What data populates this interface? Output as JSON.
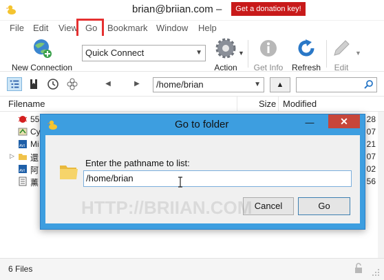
{
  "window": {
    "title": "brian@briian.com –",
    "donate_label": "Get a donation key!"
  },
  "menu": [
    "File",
    "Edit",
    "View",
    "Go",
    "Bookmark",
    "Window",
    "Help"
  ],
  "toolbar": {
    "new_connection": "New Connection",
    "quick_connect": "Quick Connect",
    "action": "Action",
    "get_info": "Get Info",
    "refresh": "Refresh",
    "edit": "Edit"
  },
  "navbar": {
    "path": "/home/brian",
    "search_placeholder": ""
  },
  "list": {
    "columns": {
      "filename": "Filename",
      "size": "Size",
      "modified": "Modified"
    },
    "rows": [
      {
        "name": "55",
        "modified": "28"
      },
      {
        "name": "Cy",
        "modified": "07"
      },
      {
        "name": "Mi",
        "modified": "21"
      },
      {
        "name": "還",
        "modified": "07"
      },
      {
        "name": "阿",
        "modified": "02"
      },
      {
        "name": "薰",
        "modified": "56"
      }
    ]
  },
  "status": {
    "text": "6 Files"
  },
  "dialog": {
    "title": "Go to folder",
    "label": "Enter the pathname to list:",
    "input_value": "/home/brian",
    "cancel": "Cancel",
    "go": "Go"
  },
  "watermark": {
    "line1": "",
    "line2": "HTTP://BRIIAN.COM"
  },
  "colors": {
    "dialog_frame": "#3d9ee0",
    "close_red": "#c7463a",
    "donate_red": "#c81a1a",
    "highlight_box": "#e53030"
  }
}
